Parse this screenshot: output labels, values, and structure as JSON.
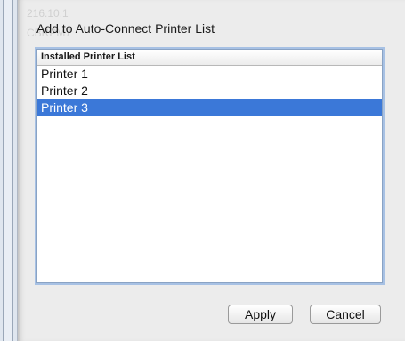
{
  "background_text": {
    "line1": "216.10.1",
    "line2": "CBRPM7"
  },
  "dialog": {
    "title": "Add to Auto-Connect Printer List",
    "list_header": "Installed Printer List",
    "printers": [
      "Printer 1",
      "Printer 2",
      "Printer 3"
    ],
    "selected_index": 2,
    "apply_label": "Apply",
    "cancel_label": "Cancel"
  },
  "colors": {
    "selection": "#3b78d8",
    "focus_ring": "#a7c1e4"
  }
}
